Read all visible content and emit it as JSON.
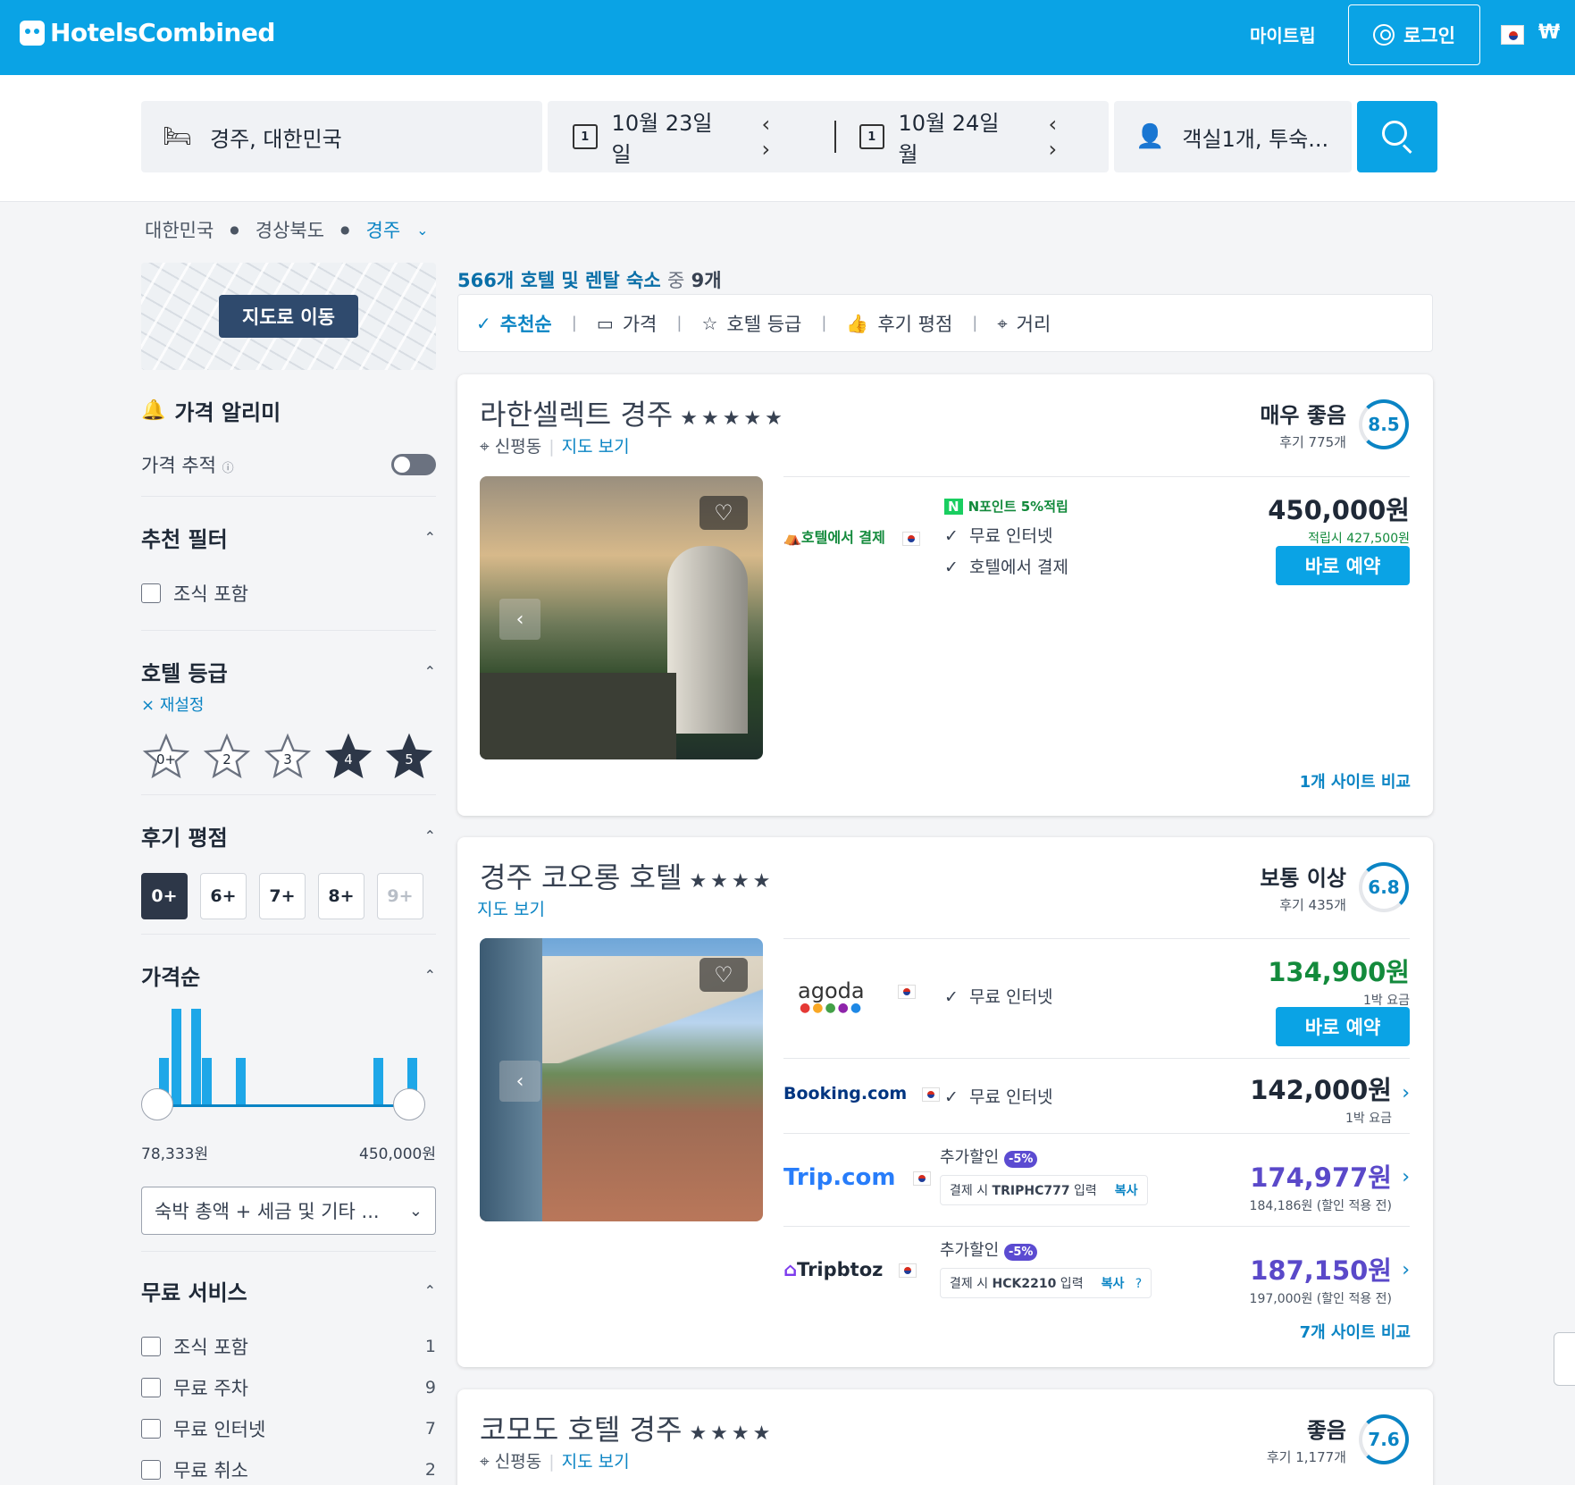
{
  "header": {
    "logo": "HotelsCombined",
    "my_trip": "마이트립",
    "login": "로그인",
    "currency": "₩"
  },
  "search": {
    "destination": "경주, 대한민국",
    "checkin": "10월 23일 일",
    "checkout": "10월 24일 월",
    "guests": "객실1개, 투숙...",
    "cal_day": "1"
  },
  "breadcrumb": [
    "대한민국",
    "경상북도",
    "경주"
  ],
  "sidebar": {
    "map_button": "지도로 이동",
    "price_alert_title": "가격 알리미",
    "price_track_label": "가격 추적",
    "recommended_title": "추천 필터",
    "breakfast_label": "조식 포함",
    "hotel_class_title": "호텔 등급",
    "reset_label": "재설정",
    "stars": [
      "0+",
      "2",
      "3",
      "4",
      "5"
    ],
    "review_title": "후기 평점",
    "review_scores": [
      "0+",
      "6+",
      "7+",
      "8+",
      "9+"
    ],
    "price_title": "가격순",
    "price_min": "78,333원",
    "price_max": "450,000원",
    "price_mode": "숙박 총액 + 세금 및 기타 ...",
    "free_title": "무료 서비스",
    "free_services": [
      {
        "label": "조식 포함",
        "count": "1"
      },
      {
        "label": "무료 주차",
        "count": "9"
      },
      {
        "label": "무료 인터넷",
        "count": "7"
      },
      {
        "label": "무료 취소",
        "count": "2"
      }
    ]
  },
  "results": {
    "count_text": "566개 호텔 및 렌탈 숙소",
    "mid_text": "중",
    "shown_text": "9개",
    "sort": [
      "추천순",
      "가격",
      "호텔 등급",
      "후기 평점",
      "거리"
    ]
  },
  "hotels": [
    {
      "name": "라한셀렉트 경주",
      "stars": "★★★★★",
      "area": "신평동",
      "map_link": "지도 보기",
      "rating_word": "매우 좋음",
      "reviews": "후기 775개",
      "score": "8.5",
      "offer": {
        "provider": "호텔에서 결제",
        "npoint": "N포인트 5%적립",
        "features": [
          "무료 인터넷",
          "호텔에서 결제"
        ],
        "price": "450,000원",
        "sub": "적립시 427,500원",
        "book": "바로 예약"
      },
      "compare": "1개 사이트 비교"
    },
    {
      "name": "경주 코오롱 호텔",
      "stars": "★★★★",
      "map_link": "지도 보기",
      "rating_word": "보통 이상",
      "reviews": "후기 435개",
      "score": "6.8",
      "offers": [
        {
          "provider": "agoda",
          "feature": "무료 인터넷",
          "price": "134,900원",
          "sub": "1박 요금",
          "book": "바로 예약"
        },
        {
          "provider": "Booking.com",
          "feature": "무료 인터넷",
          "price": "142,000원",
          "sub": "1박 요금"
        },
        {
          "provider": "Trip.com",
          "extra": "추가할인",
          "badge": "-5%",
          "coupon_prefix": "결제 시 ",
          "coupon_code": "TRIPHC777",
          "coupon_suffix": " 입력",
          "copy": "복사",
          "price": "174,977원",
          "sub": "184,186원 (할인 적용 전)"
        },
        {
          "provider": "Tripbtoz",
          "extra": "추가할인",
          "badge": "-5%",
          "coupon_prefix": "결제 시 ",
          "coupon_code": "HCK2210",
          "coupon_suffix": " 입력",
          "copy": "복사",
          "price": "187,150원",
          "sub": "197,000원 (할인 적용 전)"
        }
      ],
      "compare": "7개 사이트 비교"
    },
    {
      "name": "코모도 호텔 경주",
      "stars": "★★★★",
      "area": "신평동",
      "map_link": "지도 보기",
      "rating_word": "좋음",
      "reviews": "후기 1,177개",
      "score": "7.6"
    }
  ],
  "colors": {
    "brand": "#0aa3e5",
    "link": "#0a84c4",
    "green_price": "#138a3c",
    "purple_price": "#5a49c9"
  }
}
